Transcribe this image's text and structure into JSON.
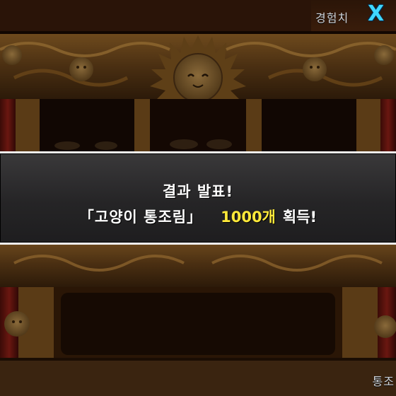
{
  "hud": {
    "exp_label": "경험치",
    "exp_value_partial": "X",
    "bottom_right_partial": "통조"
  },
  "result_banner": {
    "title": "결과 발표!",
    "item_name": "「고양이 통조림」",
    "amount": "1000개",
    "suffix": "획득!"
  },
  "colors": {
    "amount_highlight": "#ffe93a",
    "exp_value": "#3fd7ff",
    "banner_border": "#f2f2f2",
    "banner_bg": "#2e2e30"
  },
  "icons": [
    "cat-face-ornament-icon",
    "sun-cat-emblem-icon"
  ]
}
